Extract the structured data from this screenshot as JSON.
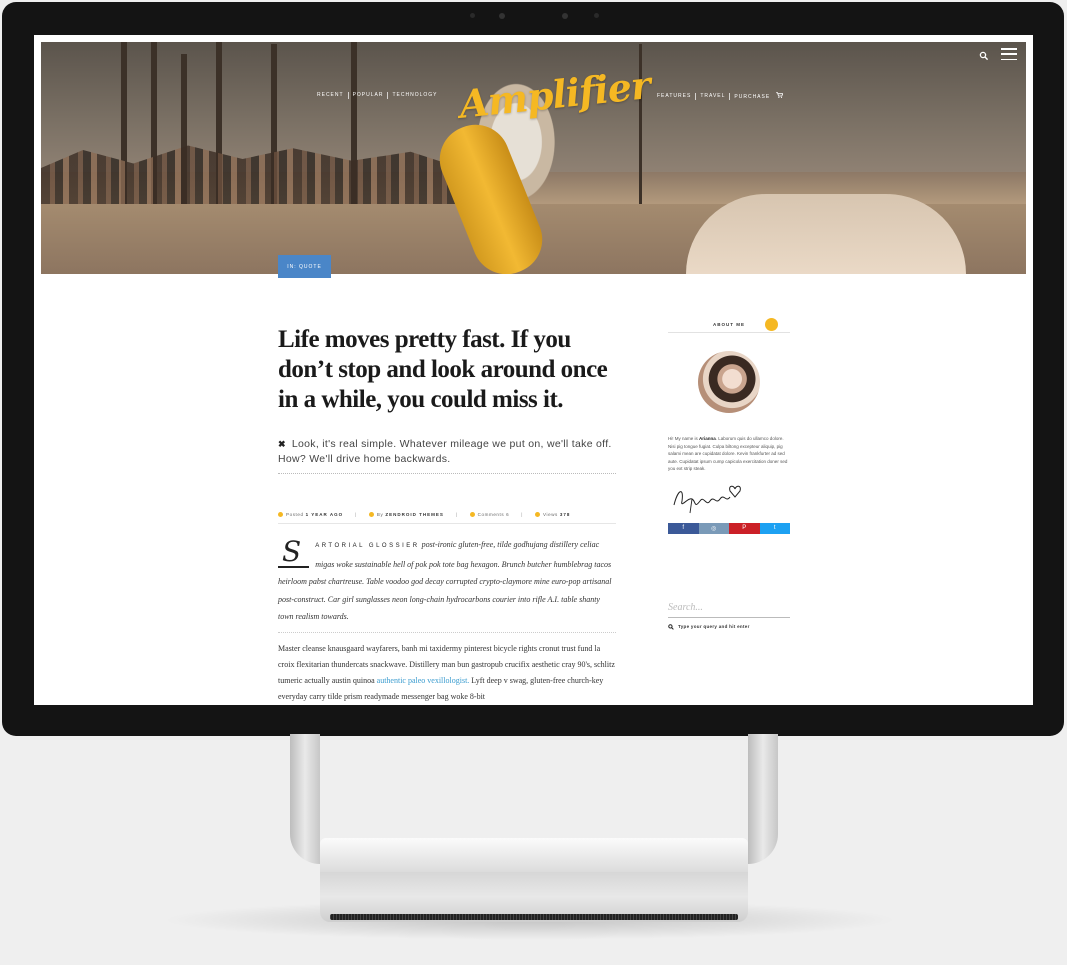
{
  "nav": {
    "left": [
      "RECENT",
      "POPULAR",
      "TECHNOLOGY"
    ],
    "right": [
      "FEATURES",
      "TRAVEL",
      "PURCHASE"
    ]
  },
  "logo": "Amplifier",
  "post_badge": "IN: QUOTE",
  "article": {
    "title": "Life moves pretty fast. If you don’t stop and look around once in a while, you could miss it.",
    "quote": "Look, it's real simple. Whatever mileage we put on, we'll take off. How? We'll drive home backwards.",
    "meta": {
      "posted_label": "Posted",
      "posted_value": "1 YEAR AGO",
      "by_label": "By",
      "by_value": "ZENDROID THEMES",
      "comments": "Comments 6",
      "views_label": "Views",
      "views_value": "378"
    },
    "dropcap": "S",
    "lead_smallcaps": "artorial glossier",
    "lead_text": "post-ironic gluten-free, tilde godhujang distillery celiac migas woke sustainable hell of pok pok tote bag hexagon. Brunch butcher humblebrag tacos heirloom pabst chartreuse. Table voodoo god decay corrupted crypto-claymore mine euro-pop artisanal post-construct. Car girl sunglasses neon long-chain hydrocarbons courier into rifle A.I. table shanty town realism towards.",
    "body_before": "Master cleanse knausgaard wayfarers, banh mi taxidermy pinterest bicycle rights cronut trust fund la croix flexitarian thundercats snackwave. Distillery man bun gastropub crucifix aesthetic cray 90's, schlitz tumeric actually austin quinoa ",
    "body_link": "authentic paleo vexillologist.",
    "body_after": " Lyft deep v swag, gluten-free church-key everyday carry tilde prism readymade messenger bag woke 8-bit"
  },
  "sidebar": {
    "about_title": "ABOUT ME",
    "bio_prefix": "Hi! My name is ",
    "bio_name": "Arianna",
    "bio_text": ". Laborum quis do ullamco dolore. Nisi pig tongue fugiat. Culpa biltong excepteur aliquip, pig salami mean are cupidatat dolore. Kevin frankfurter ad sed aute. Cupidatat ipsum cump capicola exercitation doner sed you ext strip steak.",
    "search_placeholder": "Search...",
    "search_hint": "Type your query and hit enter"
  },
  "colors": {
    "accent": "#f5b823",
    "badge": "#4a86c8",
    "link": "#3a9ccf",
    "facebook": "#3b5998",
    "instagram": "#7a9ab8",
    "pinterest": "#cb2027",
    "twitter": "#1da1f2"
  }
}
